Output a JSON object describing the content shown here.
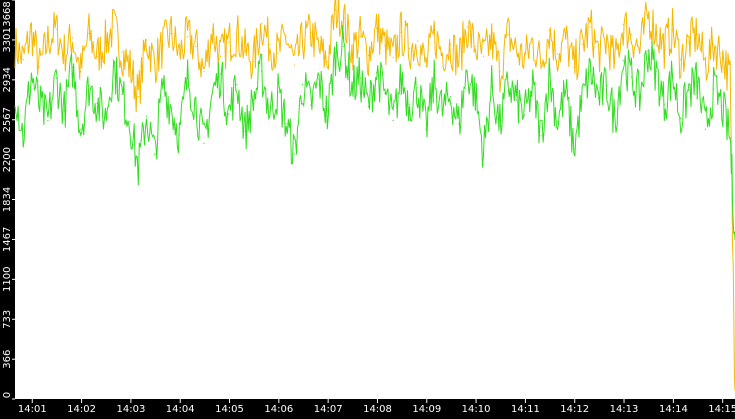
{
  "chart_data": {
    "type": "line",
    "title": "",
    "xlabel": "",
    "ylabel": "",
    "background": "#000000",
    "plot_background": "#ffffff",
    "grid": false,
    "legend": "none",
    "ylim": [
      0,
      3668
    ],
    "xlim": [
      "14:00:39",
      "14:15:15"
    ],
    "y_ticks": [
      {
        "value": 0,
        "label": "0"
      },
      {
        "value": 366,
        "label": "366"
      },
      {
        "value": 733,
        "label": "733"
      },
      {
        "value": 1100,
        "label": "1100"
      },
      {
        "value": 1467,
        "label": "1467"
      },
      {
        "value": 1834,
        "label": "1834"
      },
      {
        "value": 2200,
        "label": "2200"
      },
      {
        "value": 2567,
        "label": "2567"
      },
      {
        "value": 2934,
        "label": "2934"
      },
      {
        "value": 3301,
        "label": "3301"
      },
      {
        "value": 3668,
        "label": "3668"
      }
    ],
    "x_ticks": [
      {
        "value": "14:01:00",
        "label": "14:01"
      },
      {
        "value": "14:02:00",
        "label": "14:02"
      },
      {
        "value": "14:03:00",
        "label": "14:03"
      },
      {
        "value": "14:04:00",
        "label": "14:04"
      },
      {
        "value": "14:05:00",
        "label": "14:05"
      },
      {
        "value": "14:06:00",
        "label": "14:06"
      },
      {
        "value": "14:07:00",
        "label": "14:07"
      },
      {
        "value": "14:08:00",
        "label": "14:08"
      },
      {
        "value": "14:09:00",
        "label": "14:09"
      },
      {
        "value": "14:10:00",
        "label": "14:10"
      },
      {
        "value": "14:11:00",
        "label": "14:11"
      },
      {
        "value": "14:12:00",
        "label": "14:12"
      },
      {
        "value": "14:13:00",
        "label": "14:13"
      },
      {
        "value": "14:14:00",
        "label": "14:14"
      },
      {
        "value": "14:15:00",
        "label": "14:15"
      }
    ],
    "series": [
      {
        "color": "#f5b800",
        "x": [
          "14:00:39",
          "14:00:49",
          "14:00:59",
          "14:01:09",
          "14:01:19",
          "14:01:29",
          "14:01:39",
          "14:01:49",
          "14:01:59",
          "14:02:09",
          "14:02:19",
          "14:02:29",
          "14:02:39",
          "14:02:49",
          "14:02:59",
          "14:03:09",
          "14:03:19",
          "14:03:29",
          "14:03:39",
          "14:03:49",
          "14:03:59",
          "14:04:09",
          "14:04:19",
          "14:04:29",
          "14:04:39",
          "14:04:49",
          "14:04:59",
          "14:05:09",
          "14:05:19",
          "14:05:29",
          "14:05:39",
          "14:05:49",
          "14:05:59",
          "14:06:09",
          "14:06:19",
          "14:06:29",
          "14:06:39",
          "14:06:49",
          "14:06:59",
          "14:07:09",
          "14:07:19",
          "14:07:29",
          "14:07:39",
          "14:07:49",
          "14:07:59",
          "14:08:09",
          "14:08:19",
          "14:08:29",
          "14:08:39",
          "14:08:49",
          "14:08:59",
          "14:09:09",
          "14:09:19",
          "14:09:29",
          "14:09:39",
          "14:09:49",
          "14:09:59",
          "14:10:09",
          "14:10:19",
          "14:10:29",
          "14:10:39",
          "14:10:49",
          "14:10:59",
          "14:11:09",
          "14:11:19",
          "14:11:29",
          "14:11:39",
          "14:11:49",
          "14:11:59",
          "14:12:09",
          "14:12:19",
          "14:12:29",
          "14:12:39",
          "14:12:49",
          "14:12:59",
          "14:13:09",
          "14:13:19",
          "14:13:29",
          "14:13:39",
          "14:13:49",
          "14:13:59",
          "14:14:09",
          "14:14:19",
          "14:14:29",
          "14:14:39",
          "14:14:49",
          "14:14:59",
          "14:15:09",
          "14:15:15"
        ],
        "values": [
          3250,
          3120,
          3380,
          3050,
          3290,
          3400,
          3180,
          3320,
          3010,
          3360,
          3150,
          3280,
          3420,
          3190,
          3050,
          2780,
          3300,
          3080,
          3250,
          3360,
          3170,
          3330,
          3240,
          3010,
          3390,
          3150,
          3280,
          3360,
          3200,
          3100,
          3450,
          3260,
          3180,
          3330,
          3070,
          3290,
          3370,
          3210,
          3100,
          3580,
          3500,
          3210,
          3330,
          3160,
          3410,
          3250,
          3140,
          3370,
          3220,
          3290,
          3060,
          3350,
          3180,
          3260,
          3110,
          3420,
          3240,
          3150,
          3300,
          3010,
          3350,
          3200,
          3130,
          3280,
          3090,
          3390,
          3170,
          3310,
          3050,
          3260,
          3420,
          3180,
          3300,
          3090,
          3440,
          3350,
          3200,
          3530,
          3380,
          3240,
          3390,
          3120,
          3280,
          3350,
          3070,
          3260,
          3180,
          2950,
          80
        ]
      },
      {
        "color": "#33dd22",
        "x": [
          "14:00:39",
          "14:00:49",
          "14:00:59",
          "14:01:09",
          "14:01:19",
          "14:01:29",
          "14:01:39",
          "14:01:49",
          "14:01:59",
          "14:02:09",
          "14:02:19",
          "14:02:29",
          "14:02:39",
          "14:02:49",
          "14:02:59",
          "14:03:09",
          "14:03:19",
          "14:03:29",
          "14:03:39",
          "14:03:49",
          "14:03:59",
          "14:04:09",
          "14:04:19",
          "14:04:29",
          "14:04:39",
          "14:04:49",
          "14:04:59",
          "14:05:09",
          "14:05:19",
          "14:05:29",
          "14:05:39",
          "14:05:49",
          "14:05:59",
          "14:06:09",
          "14:06:19",
          "14:06:29",
          "14:06:39",
          "14:06:49",
          "14:06:59",
          "14:07:09",
          "14:07:19",
          "14:07:29",
          "14:07:39",
          "14:07:49",
          "14:07:59",
          "14:08:09",
          "14:08:19",
          "14:08:29",
          "14:08:39",
          "14:08:49",
          "14:08:59",
          "14:09:09",
          "14:09:19",
          "14:09:29",
          "14:09:39",
          "14:09:49",
          "14:09:59",
          "14:10:09",
          "14:10:19",
          "14:10:29",
          "14:10:39",
          "14:10:49",
          "14:10:59",
          "14:11:09",
          "14:11:19",
          "14:11:29",
          "14:11:39",
          "14:11:49",
          "14:11:59",
          "14:12:09",
          "14:12:19",
          "14:12:29",
          "14:12:39",
          "14:12:49",
          "14:12:59",
          "14:13:09",
          "14:13:19",
          "14:13:29",
          "14:13:39",
          "14:13:49",
          "14:13:59",
          "14:14:09",
          "14:14:19",
          "14:14:29",
          "14:14:39",
          "14:14:49",
          "14:14:59",
          "14:15:09",
          "14:15:15"
        ],
        "values": [
          2850,
          2420,
          2980,
          2700,
          2560,
          2950,
          2650,
          3050,
          2480,
          2880,
          2720,
          2590,
          3060,
          2800,
          2550,
          2120,
          2600,
          2250,
          2890,
          2680,
          2430,
          2950,
          2700,
          2350,
          2810,
          2990,
          2620,
          2890,
          2460,
          2750,
          3010,
          2640,
          2820,
          2530,
          2250,
          2890,
          2700,
          2940,
          2600,
          3180,
          3240,
          2860,
          2950,
          2690,
          3000,
          2810,
          2560,
          2940,
          2710,
          2860,
          2480,
          2920,
          2650,
          2780,
          2530,
          3010,
          2800,
          2270,
          2870,
          2510,
          2900,
          2750,
          2610,
          2860,
          2420,
          2980,
          2550,
          2830,
          2300,
          2740,
          3020,
          2770,
          2880,
          2570,
          3110,
          2960,
          2780,
          3200,
          3010,
          2710,
          2980,
          2580,
          2840,
          2920,
          2480,
          2850,
          2700,
          2400,
          1470
        ]
      }
    ]
  }
}
